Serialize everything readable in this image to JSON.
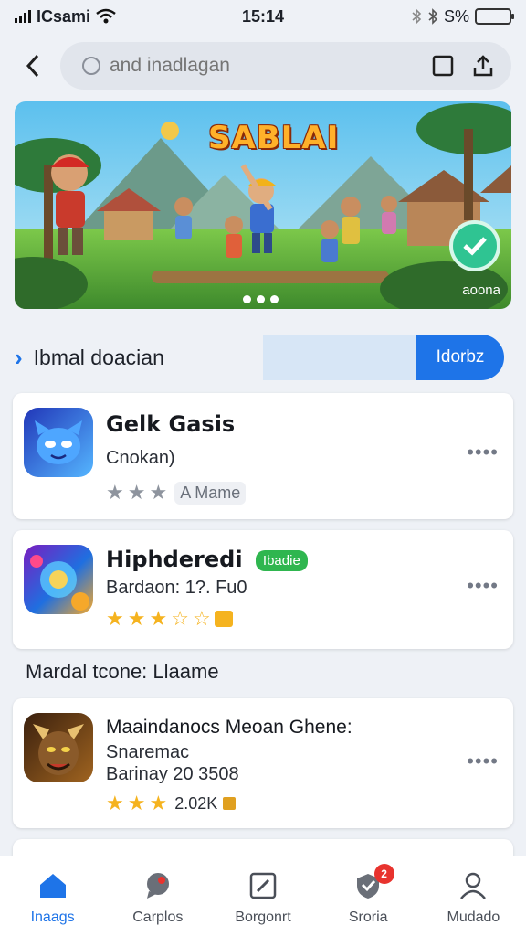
{
  "status_bar": {
    "carrier": "ICsami",
    "time": "15:14",
    "battery": "S%"
  },
  "search": {
    "placeholder": "and inadlagan"
  },
  "banner": {
    "title": "SABLAI",
    "caption": "aoona",
    "dots": 3
  },
  "section_row": {
    "link": "Ibmal doacian",
    "input_placeholder": "",
    "button": "Idorbz"
  },
  "apps": [
    {
      "name": "Gelk Gasis",
      "line1": "Cnokan)",
      "line2": "",
      "tag": "",
      "stars": 3,
      "rating_label": "A Mame",
      "colors": [
        "#2a3fc7",
        "#58b8ff"
      ]
    },
    {
      "name": "Hiphderedi",
      "line1": "Bardaon: 1?. Fu0",
      "line2": "",
      "tag": "Ibadie",
      "stars": 5,
      "rating_label": "",
      "colors": [
        "#7a1cc0",
        "#f6a82a"
      ]
    }
  ],
  "section2": {
    "title": "Mardal tcone: Llaame"
  },
  "featured": {
    "name": "Maaindanocs Meoan Ghene:",
    "line1": "Snaremac",
    "line2": "Barinay 20 3508",
    "stars": 3,
    "rating_label": "2.02K",
    "colors": [
      "#4a2a12",
      "#e0a640"
    ]
  },
  "nav": [
    {
      "label": "Inaags",
      "icon": "home-icon",
      "active": true
    },
    {
      "label": "Carplos",
      "icon": "chat-icon",
      "active": false
    },
    {
      "label": "Borgonrt",
      "icon": "edit-icon",
      "active": false
    },
    {
      "label": "Sroria",
      "icon": "shield-icon",
      "active": false,
      "badge": "2"
    },
    {
      "label": "Mudado",
      "icon": "person-icon",
      "active": false
    }
  ],
  "theme": {
    "accent": "#1e74e8",
    "star": "#f5b31f",
    "tag_green": "#2fb64f"
  }
}
